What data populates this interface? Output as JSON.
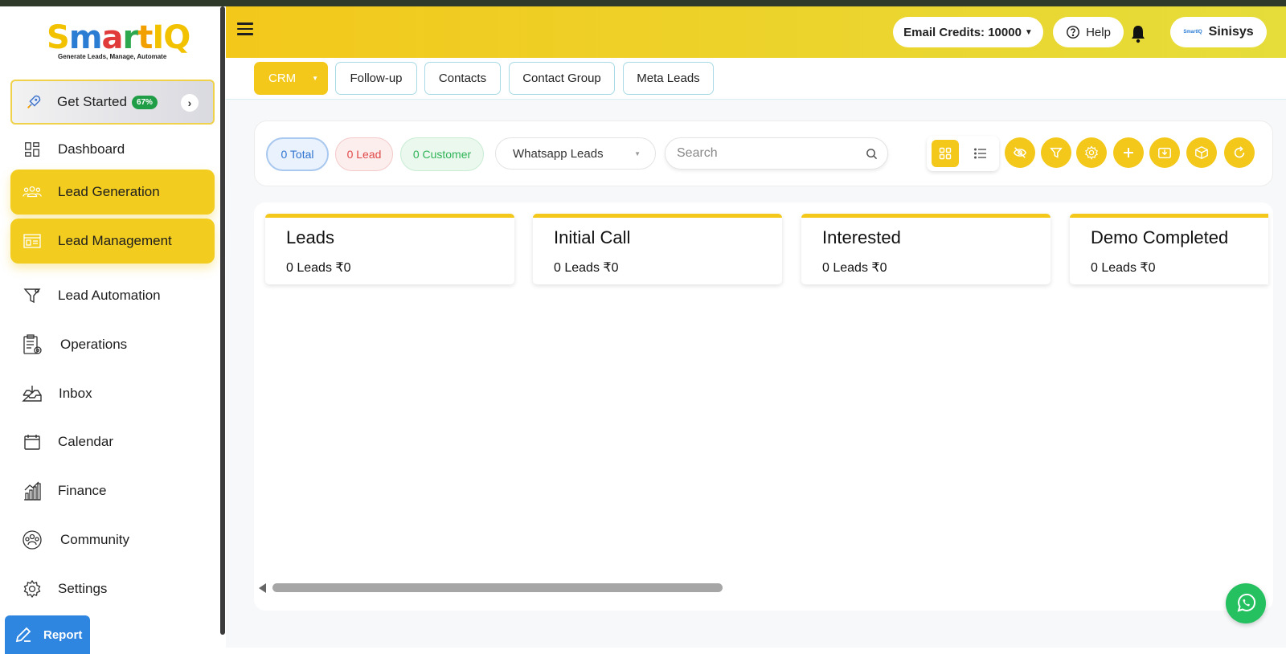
{
  "sidebar": {
    "logo_text": "SmartIQ",
    "logo_tagline": "Generate Leads, Manage, Automate",
    "get_started": {
      "label": "Get Started",
      "progress": "67%"
    },
    "items": [
      {
        "label": "Dashboard",
        "icon": "dashboard-icon",
        "active": false
      },
      {
        "label": "Lead Generation",
        "icon": "users-group-icon",
        "active": true
      },
      {
        "label": "Lead Management",
        "icon": "contact-card-icon",
        "active": true
      },
      {
        "label": "Lead Automation",
        "icon": "funnel-icon",
        "active": false
      },
      {
        "label": "Operations",
        "icon": "clipboard-gear-icon",
        "active": false
      },
      {
        "label": "Inbox",
        "icon": "inbox-icon",
        "active": false
      },
      {
        "label": "Calendar",
        "icon": "calendar-icon",
        "active": false
      },
      {
        "label": "Finance",
        "icon": "finance-chart-icon",
        "active": false
      },
      {
        "label": "Community",
        "icon": "community-icon",
        "active": false
      },
      {
        "label": "Settings",
        "icon": "gear-icon",
        "active": false
      }
    ],
    "report_label": "Report"
  },
  "header": {
    "email_credits": "Email Credits: 10000",
    "help_label": "Help",
    "user_name": "Sinisys",
    "accent": "#f3c81b"
  },
  "tabs": [
    {
      "label": "CRM"
    },
    {
      "label": "Follow-up"
    },
    {
      "label": "Contacts"
    },
    {
      "label": "Contact Group"
    },
    {
      "label": "Meta Leads"
    }
  ],
  "filters": {
    "total": "0 Total",
    "lead": "0 Lead",
    "customer": "0 Customer",
    "source_selected": "Whatsapp Leads",
    "search_placeholder": "Search"
  },
  "stages": [
    {
      "title": "Leads",
      "summary": "0 Leads ₹0"
    },
    {
      "title": "Initial Call",
      "summary": "0 Leads ₹0"
    },
    {
      "title": "Interested",
      "summary": "0 Leads ₹0"
    },
    {
      "title": "Demo Completed",
      "summary": "0 Leads ₹0"
    }
  ]
}
